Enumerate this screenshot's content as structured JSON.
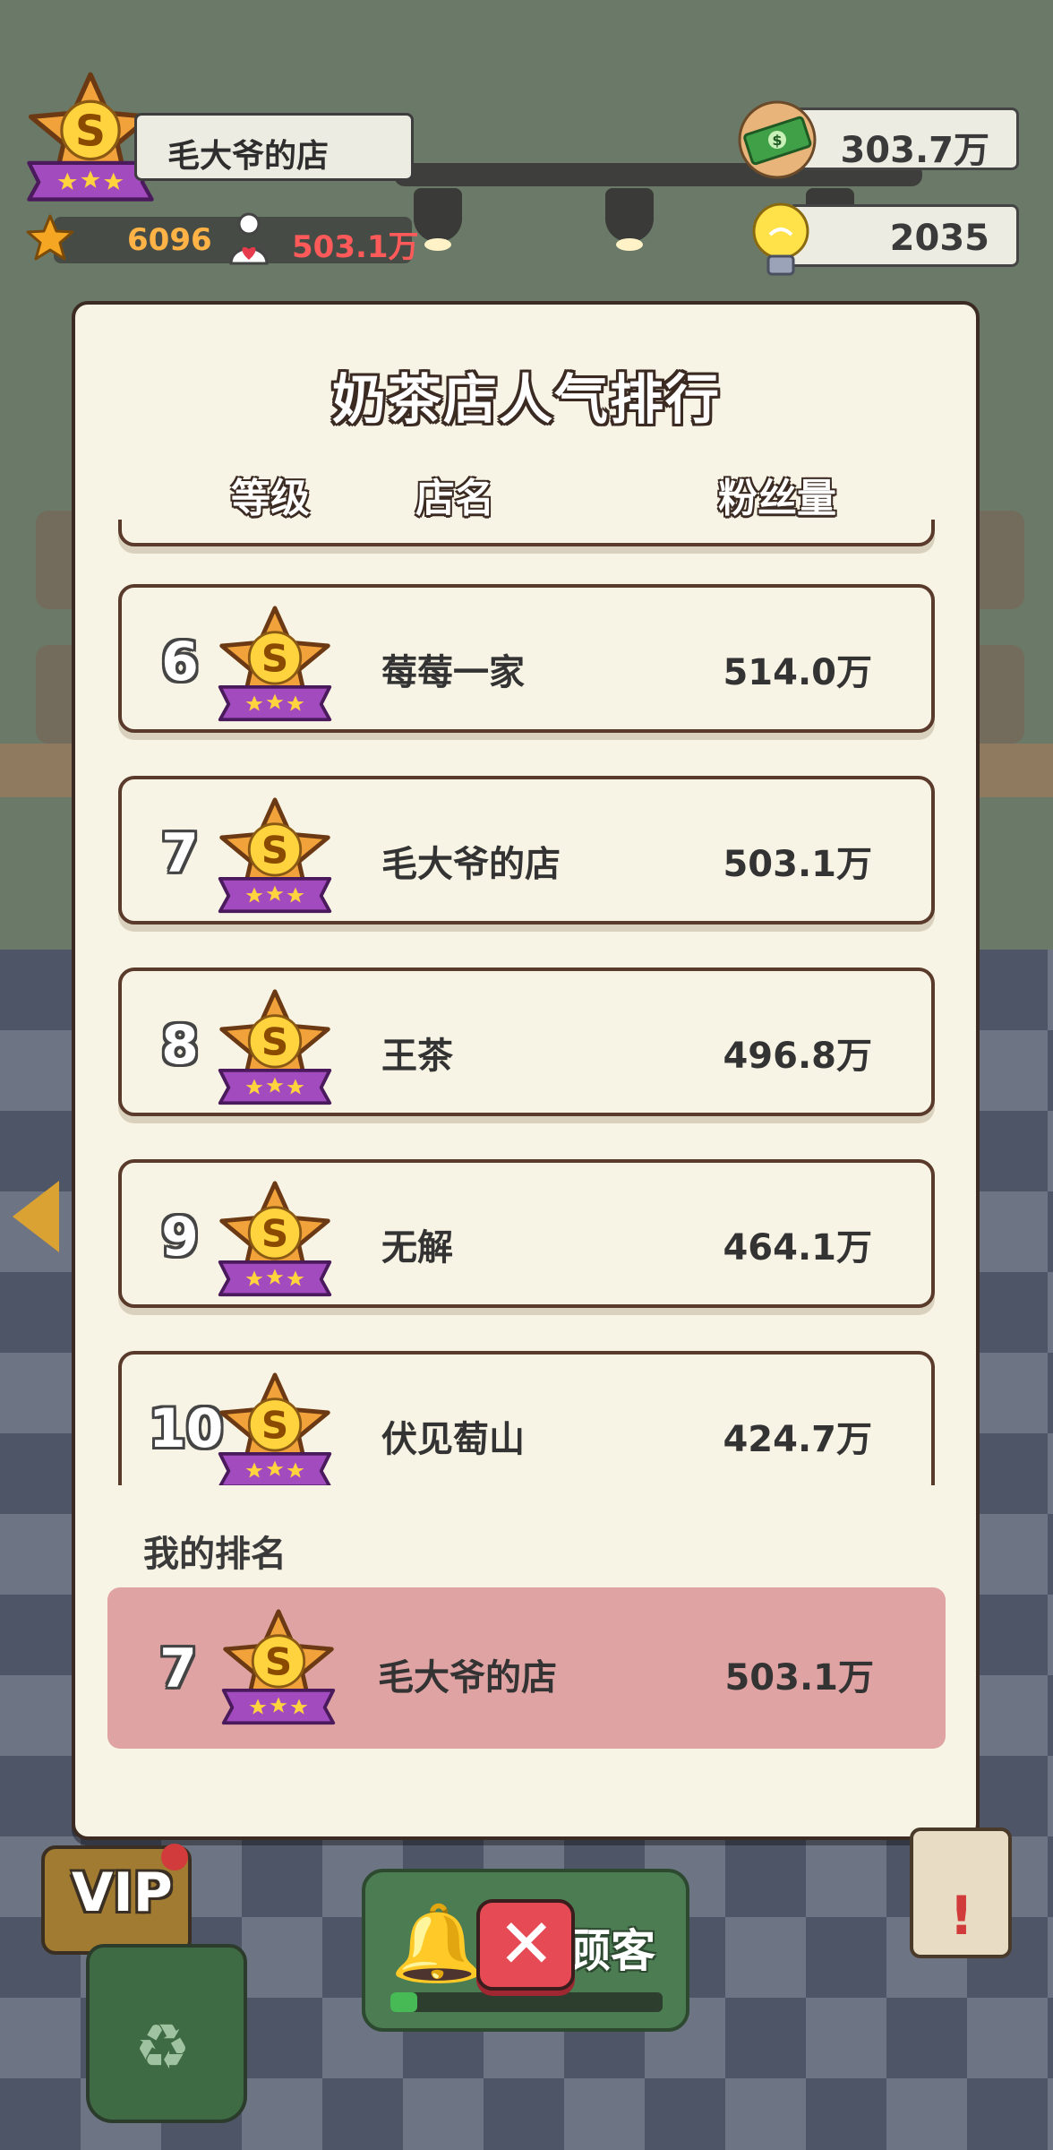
{
  "player": {
    "shop_name": "毛大爷的店",
    "stars": "6096",
    "fans": "503.1万",
    "grade": "S"
  },
  "resources": {
    "cash": "303.7万",
    "ideas": "2035"
  },
  "ranking": {
    "title": "奶茶店人气排行",
    "columns": {
      "level": "等级",
      "name": "店名",
      "fans": "粉丝量"
    },
    "rows": [
      {
        "rank": "6",
        "name": "莓莓一家",
        "fans": "514.0万"
      },
      {
        "rank": "7",
        "name": "毛大爷的店",
        "fans": "503.1万"
      },
      {
        "rank": "8",
        "name": "王茶",
        "fans": "496.8万"
      },
      {
        "rank": "9",
        "name": "无解",
        "fans": "464.1万"
      },
      {
        "rank": "10",
        "name": "伏见萄山",
        "fans": "424.7万"
      }
    ],
    "my_label": "我的排名",
    "mine": {
      "rank": "7",
      "name": "毛大爷的店",
      "fans": "503.1万"
    }
  },
  "bottom": {
    "vip": "VIP",
    "call_label": "顾客",
    "call_progress": 0.1
  },
  "colors": {
    "modal_bg": "#f8f4e5",
    "row_border": "#5a3a2a",
    "my_row_bg": "#e0a3a3",
    "close_btn": "#e64a55",
    "badge_gold": "#f2b01e",
    "badge_ribbon": "#9b44b8"
  },
  "icons": [
    "grade-s-badge-icon",
    "star-icon",
    "fan-heart-icon",
    "cash-icon",
    "lightbulb-icon",
    "bell-icon",
    "close-icon",
    "recycle-icon",
    "left-arrow-icon"
  ]
}
